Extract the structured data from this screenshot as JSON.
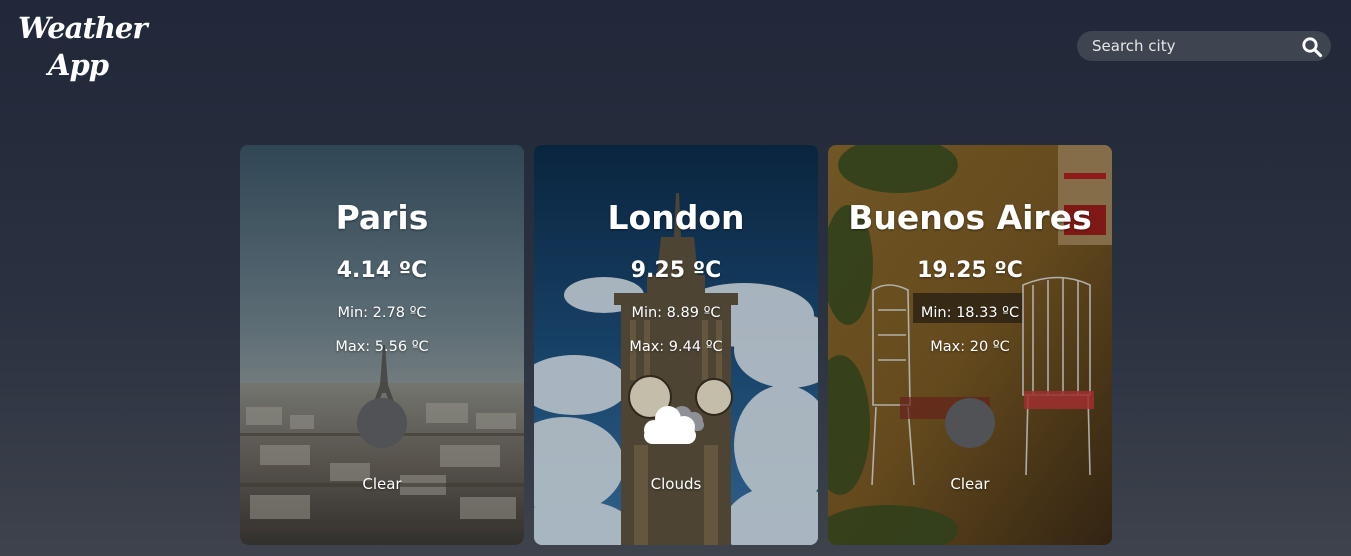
{
  "app": {
    "logo_line1": "Weather",
    "logo_line2": "App"
  },
  "search": {
    "placeholder": "Search city",
    "icon": "search-icon"
  },
  "cards": [
    {
      "city": "Paris",
      "temp": "4.14 ºC",
      "min": "Min: 2.78 ºC",
      "max": "Max: 5.56 ºC",
      "icon": "broken-image-icon",
      "description": "Clear",
      "background": "eiffel-tower-photo"
    },
    {
      "city": "London",
      "temp": "9.25 ºC",
      "min": "Min: 8.89 ºC",
      "max": "Max: 9.44 ºC",
      "icon": "clouds-icon",
      "description": "Clouds",
      "background": "big-ben-photo"
    },
    {
      "city": "Buenos Aires",
      "temp": "19.25 ºC",
      "min": "Min: 18.33 ºC",
      "max": "Max: 20 ºC",
      "icon": "broken-image-icon",
      "description": "Clear",
      "background": "buenos-aires-patio-photo"
    }
  ],
  "colors": {
    "background_top": "#202839",
    "background_bottom": "#3e434c",
    "search_bg": "#3e4450",
    "text": "#ffffff"
  }
}
